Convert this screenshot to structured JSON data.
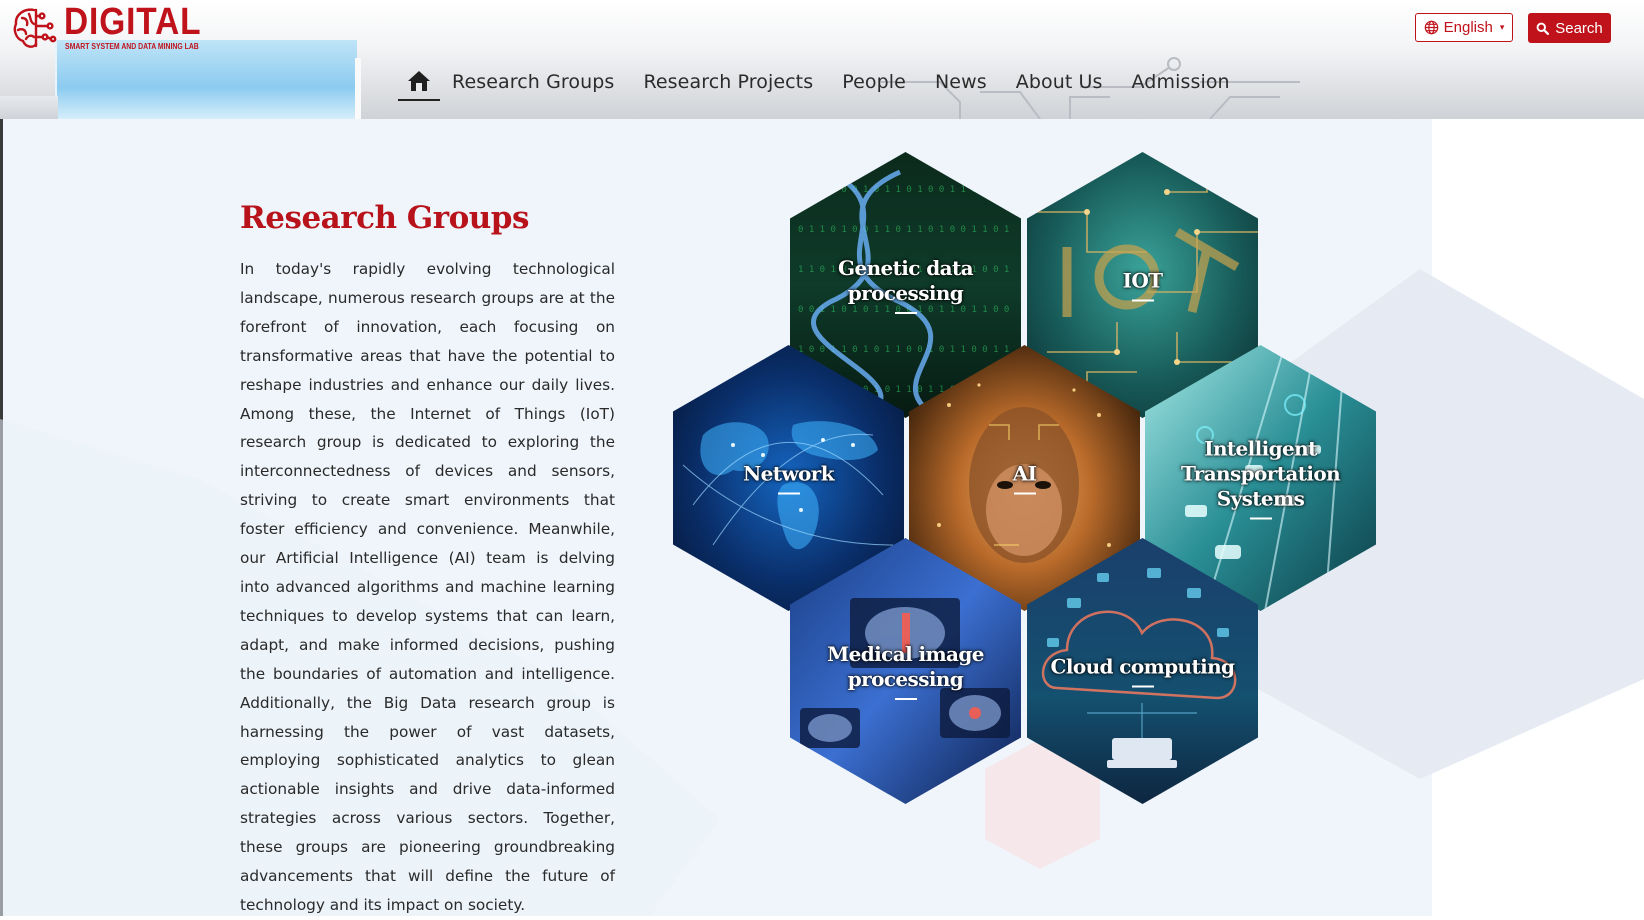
{
  "brand": {
    "name": "DIGITAL",
    "tagline": "SMART SYSTEM AND DATA MINING LAB",
    "color": "#c0121b"
  },
  "header": {
    "language_label": "English",
    "search_label": "Search"
  },
  "nav": {
    "items": [
      {
        "label": "Research Groups"
      },
      {
        "label": "Research Projects"
      },
      {
        "label": "People"
      },
      {
        "label": "News"
      },
      {
        "label": "About Us"
      },
      {
        "label": "Admission"
      }
    ]
  },
  "main": {
    "title": "Research Groups",
    "paragraph": "In today's rapidly evolving technological landscape, numerous research groups are at the forefront of innovation, each focusing on transformative areas that have the potential to reshape industries and enhance our daily lives. Among these, the Internet of Things (IoT) research group is dedicated to exploring the interconnectedness of devices and sensors, striving to create smart environments that foster efficiency and convenience. Meanwhile, our Artificial Intelligence (AI) team is delving into advanced algorithms and machine learning techniques to develop systems that can learn, adapt, and make informed decisions, pushing the boundaries of automation and intelligence. Additionally, the Big Data research group is harnessing the power of vast datasets, employing sophisticated analytics to glean actionable insights and drive data-informed strategies across various sectors. Together, these groups are pioneering groundbreaking advancements that will define the future of technology and its impact on society."
  },
  "groups": [
    {
      "label": "Genetic data processing"
    },
    {
      "label": "IOT"
    },
    {
      "label": "Network"
    },
    {
      "label": "AI"
    },
    {
      "label": "Intelligent Transportation Systems"
    },
    {
      "label": "Medical image processing"
    },
    {
      "label": "Cloud computing"
    }
  ]
}
